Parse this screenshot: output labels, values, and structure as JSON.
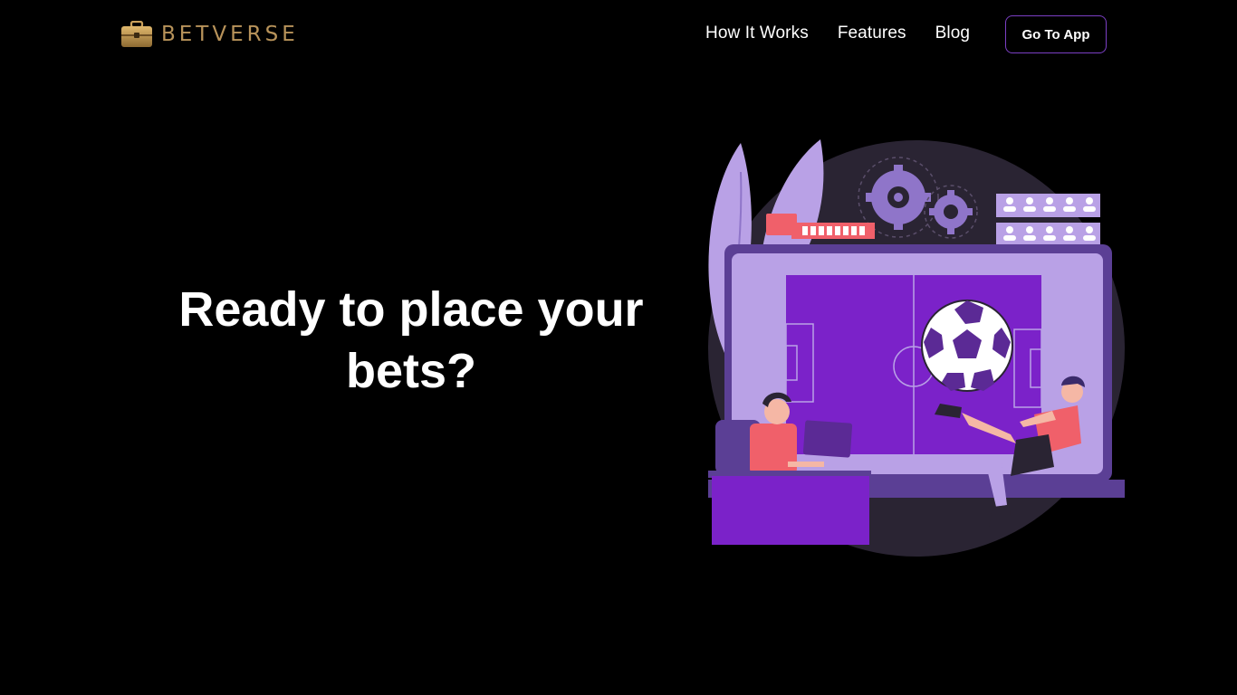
{
  "brand": {
    "name": "BETVERSE",
    "color": "#b8935a"
  },
  "nav": {
    "links": [
      {
        "label": "How It Works"
      },
      {
        "label": "Features"
      },
      {
        "label": "Blog"
      }
    ],
    "cta_label": "Go To App",
    "cta_border_color": "#7b3fc4"
  },
  "hero": {
    "title": "Ready to place your bets?"
  },
  "illustration": {
    "subject": "football-betting-illustration",
    "colors": {
      "purple": "#7b22c9",
      "lavender": "#b9a1e6",
      "dark": "#2a2433",
      "red": "#f0606a"
    }
  }
}
